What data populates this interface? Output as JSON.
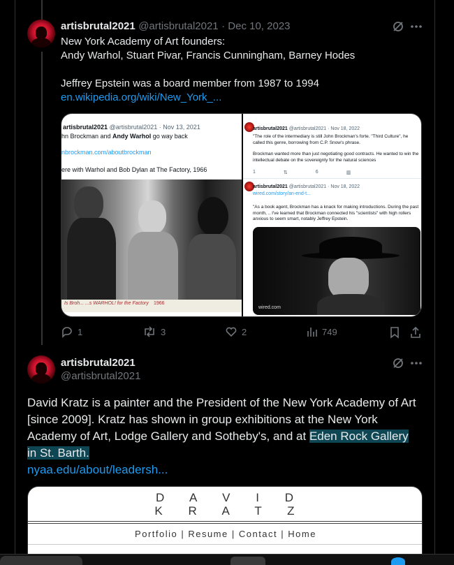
{
  "tweet1": {
    "display_name": "artisbrutal2021",
    "handle": "@artisbrutal2021",
    "date": "Dec 10, 2023",
    "line1": "New York Academy of Art founders:",
    "line2": "Andy Warhol, Stuart Pivar, Francis Cunningham, Barney Hodes",
    "line3": "Jeffrey Epstein was a board member from 1987 to 1994",
    "link": "en.wikipedia.org/wiki/New_York_...",
    "actions": {
      "replies": "1",
      "retweets": "3",
      "likes": "2",
      "views": "749"
    }
  },
  "embed_left": {
    "name": "artisbrutal2021",
    "handle": "@artisbrutal2021 · Nov 13, 2021",
    "line1_prefix": "hn Brockman and ",
    "line1_bold": "Andy Warhol",
    "line1_suffix": " go way back",
    "link": "nbrockman.com/aboutbrockman",
    "caption": "ere with Warhol and Bob Dylan at The Factory, 1966",
    "photo_note": "Is Broh... ...s WARHOL! for the Factory",
    "photo_year": "1966"
  },
  "embed_right_top": {
    "name": "artisbrutal2021",
    "handle": "@artisbrutal2021 · Nov 18, 2022",
    "quote": "\"The role of the intermediary is still John Brockman's forte. \"Third Culture\", he called this genre, borrowing from C.P. Snow's phrase.",
    "quote2": "Brockman wanted more than just negotiating good contracts. He wanted to win the intellectual debate on the sovereignty for the natural sciences",
    "replies": "1",
    "likes": "6"
  },
  "embed_right_bottom": {
    "name": "artisbrutal2021",
    "handle": "@artisbrutal2021 · Nov 18, 2022",
    "link": "wired.com/story/an-end-t...",
    "quote": "\"As a book agent, Brockman has a knack for making introductions. During the past month, .. I've learned that Brockman connected his \"scientists\" with high rollers anxious to seem smart, notably Jeffrey Epstein.",
    "source": "wired.com"
  },
  "tweet2": {
    "display_name": "artisbrutal2021",
    "handle": "@artisbrutal2021",
    "text_part1": "David Kratz is a painter and the President of the New York Academy of Art [since 2009]. Kratz has shown in group exhibitions at the New York Academy of Art,  Lodge Gallery and Sotheby's, and at ",
    "text_highlight_a": "Eden Rock Gallery",
    "text_highlight_b": "in St. Barth.",
    "link": "nyaa.edu/about/leadersh..."
  },
  "kratz_card": {
    "line1": "D A V I D",
    "line2": "K R A T Z",
    "nav": "Portfolio | Resume | Contact | Home"
  },
  "colors": {
    "link": "#1d9bf0",
    "muted": "#71767b",
    "highlight": "#0f4654",
    "avatar": "#c8102e"
  },
  "icons": [
    "grok-icon",
    "more-icon",
    "reply-icon",
    "retweet-icon",
    "like-icon",
    "views-icon",
    "bookmark-icon",
    "share-icon"
  ]
}
